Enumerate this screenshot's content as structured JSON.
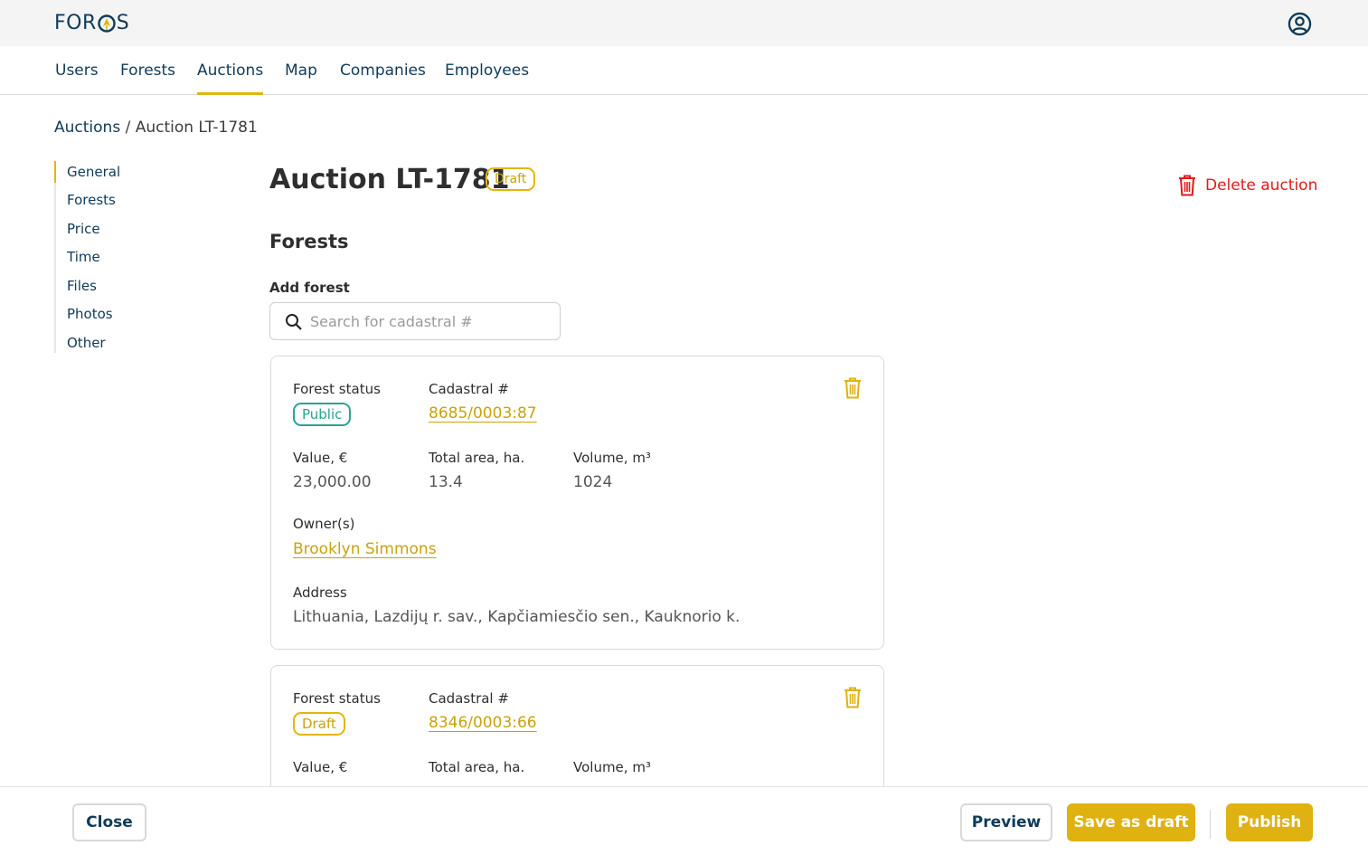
{
  "brand": {
    "logo": "FOROS",
    "logo_prefix": "FOR",
    "logo_suffix": "S"
  },
  "nav": {
    "items": [
      {
        "label": "Users"
      },
      {
        "label": "Forests"
      },
      {
        "label": "Auctions",
        "active": true
      },
      {
        "label": "Map"
      },
      {
        "label": "Companies"
      },
      {
        "label": "Employees"
      }
    ]
  },
  "breadcrumb": {
    "root": "Auctions",
    "separator": "/",
    "current": "Auction LT-1781"
  },
  "sidebar": {
    "items": [
      {
        "label": "General",
        "active": true
      },
      {
        "label": "Forests"
      },
      {
        "label": "Price"
      },
      {
        "label": "Time"
      },
      {
        "label": "Files"
      },
      {
        "label": "Photos"
      },
      {
        "label": "Other"
      }
    ]
  },
  "page": {
    "title": "Auction LT-1781",
    "status": "Draft",
    "delete_label": "Delete auction"
  },
  "forests_section": {
    "title": "Forests",
    "add_label": "Add forest",
    "search_placeholder": "Search for cadastral #"
  },
  "labels": {
    "forest_status": "Forest status",
    "cadastral": "Cadastral #",
    "value": "Value, €",
    "total_area": "Total area, ha.",
    "volume": "Volume, m³",
    "owners": "Owner(s)",
    "address": "Address"
  },
  "forests": [
    {
      "status": "Public",
      "cadastral": "8685/0003:87",
      "value": "23,000.00",
      "total_area": "13.4",
      "volume": "1024",
      "owner": "Brooklyn Simmons",
      "address": "Lithuania, Lazdijų r. sav., Kapčiamiesčio sen., Kauknorio k."
    },
    {
      "status": "Draft",
      "cadastral": "8346/0003:66"
    }
  ],
  "footer": {
    "close": "Close",
    "preview": "Preview",
    "save_draft": "Save as draft",
    "publish": "Publish"
  },
  "colors": {
    "accent": "#dfb212",
    "navy": "#0f3b57",
    "danger": "#e21b1b",
    "public": "#2aa391"
  }
}
